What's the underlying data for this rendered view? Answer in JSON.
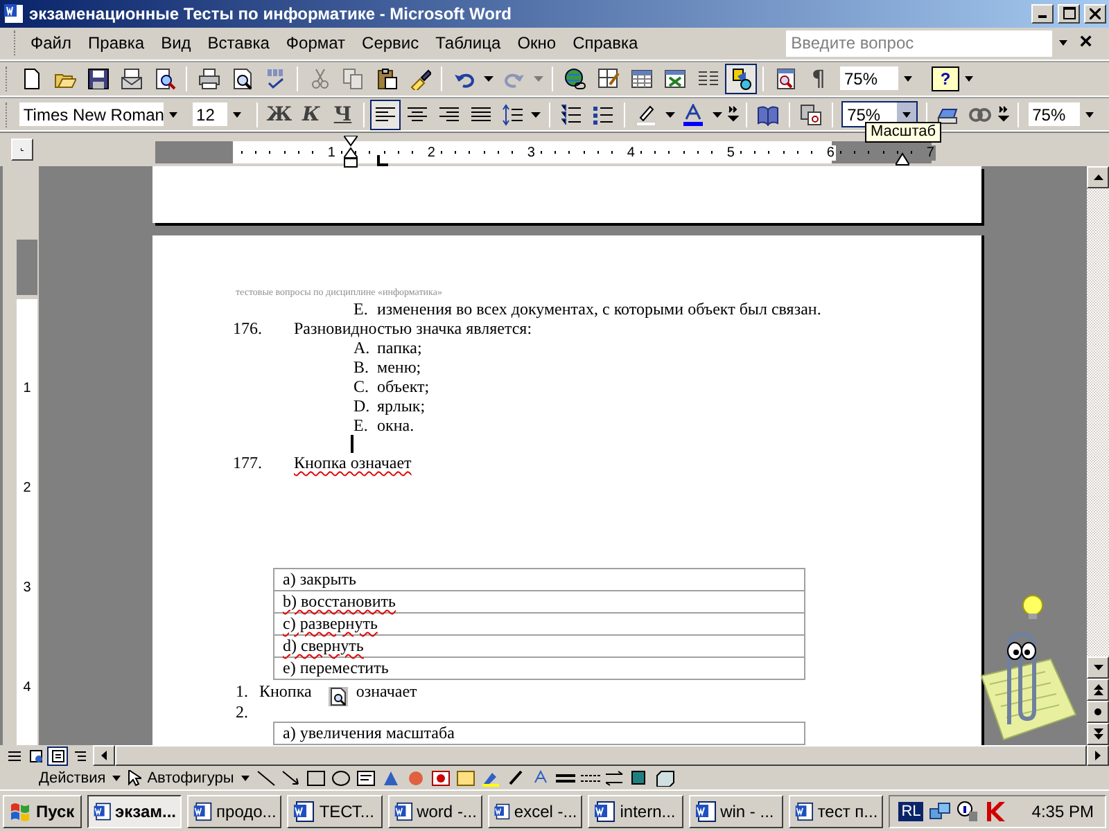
{
  "window": {
    "title": "экзаменационные Тесты по информатике - Microsoft Word"
  },
  "menu": [
    {
      "label": "Файл"
    },
    {
      "label": "Правка"
    },
    {
      "label": "Вид"
    },
    {
      "label": "Вставка"
    },
    {
      "label": "Формат"
    },
    {
      "label": "Сервис"
    },
    {
      "label": "Таблица"
    },
    {
      "label": "Окно"
    },
    {
      "label": "Справка"
    }
  ],
  "help_box": {
    "placeholder": "Введите вопрос"
  },
  "close_document": "×",
  "standard_toolbar": {
    "buttons": [
      {
        "kind": "new",
        "disabled": false
      },
      {
        "kind": "open",
        "disabled": false
      },
      {
        "kind": "save",
        "disabled": false
      },
      {
        "kind": "permission",
        "disabled": false
      },
      {
        "kind": "find",
        "disabled": false
      },
      {
        "kind": "sep"
      },
      {
        "kind": "print",
        "disabled": false
      },
      {
        "kind": "preview",
        "disabled": false
      },
      {
        "kind": "spelling",
        "disabled": false
      },
      {
        "kind": "sep"
      },
      {
        "kind": "cut",
        "disabled": true
      },
      {
        "kind": "copy",
        "disabled": true
      },
      {
        "kind": "paste",
        "disabled": false
      },
      {
        "kind": "painter",
        "disabled": false
      },
      {
        "kind": "sep"
      },
      {
        "kind": "undo",
        "disabled": false
      },
      {
        "kind": "dropdown",
        "disabled": false
      },
      {
        "kind": "redo",
        "disabled": true
      },
      {
        "kind": "dropdown",
        "disabled": true
      },
      {
        "kind": "sep"
      },
      {
        "kind": "hyperlink",
        "disabled": false
      },
      {
        "kind": "borders",
        "disabled": false
      },
      {
        "kind": "table",
        "disabled": false
      },
      {
        "kind": "sheet",
        "disabled": false
      },
      {
        "kind": "columns",
        "disabled": false
      }
    ],
    "drawing_pressed": true,
    "pilcrow": "¶",
    "zoom": "75%",
    "help_glyph": "?"
  },
  "formatting_toolbar": {
    "font": "Times New Roman",
    "size": "12",
    "bold": "Ж",
    "italic": "К",
    "underline": "Ч",
    "align_buttons": [
      {
        "selected": true
      },
      {
        "selected": false
      },
      {
        "selected": false
      },
      {
        "selected": false
      }
    ],
    "zoom": "75%",
    "zoom_focused": true,
    "tooltip": "Масштаб",
    "zoom_extra": "75%"
  },
  "ruler": {
    "labels": [
      "1",
      "2",
      "3",
      "4",
      "5",
      "6",
      "7"
    ]
  },
  "vertical_ruler": {
    "labels": [
      "1",
      "2",
      "3",
      "4"
    ]
  },
  "document": {
    "header": "тестовые вопросы по дисциплине «информатика»",
    "carry_line": {
      "letter": "E.",
      "text": "изменения во всех документах, с которыми объект был связан."
    },
    "questions": [
      {
        "number": "176.",
        "text": "Разновидностью значка является:",
        "spell_error": false,
        "options": [
          {
            "letter": "A.",
            "text": "папка;"
          },
          {
            "letter": "B.",
            "text": "меню;"
          },
          {
            "letter": "C.",
            "text": "объект;"
          },
          {
            "letter": "D.",
            "text": "ярлык;"
          },
          {
            "letter": "E.",
            "text": "окна."
          }
        ]
      },
      {
        "number": "177.",
        "text": "Кнопка означает",
        "spell_error": true
      }
    ],
    "table_1": [
      {
        "text": "a) закрыть",
        "spell_error": false
      },
      {
        "text": "b) восстановить",
        "spell_error": true
      },
      {
        "text": "c) развернуть",
        "spell_error": true
      },
      {
        "text": "d) свернуть",
        "spell_error": true
      },
      {
        "text": "e) переместить",
        "spell_error": false
      }
    ],
    "numbered": [
      {
        "number": "1.",
        "before": "Кнопка",
        "after": "означает",
        "has_icon": true
      },
      {
        "number": "2.",
        "has_icon": false
      }
    ],
    "table_2": [
      {
        "text": "a) увеличения масштаба",
        "spell_error": false
      }
    ]
  },
  "drawing_toolbar": {
    "actions": "Действия",
    "autoshapes": "Автофигуры"
  },
  "taskbar": {
    "start": "Пуск",
    "tasks": [
      {
        "label": "экзам...",
        "selected": true
      },
      {
        "label": "продо...",
        "selected": false
      },
      {
        "label": "ТЕСТ...",
        "selected": false
      },
      {
        "label": "word -...",
        "selected": false
      },
      {
        "label": "excel -...",
        "selected": false
      },
      {
        "label": "intern...",
        "selected": false
      },
      {
        "label": "win - ...",
        "selected": false
      },
      {
        "label": "тест п...",
        "selected": false
      }
    ],
    "language": "RL",
    "time": "4:35 PM"
  }
}
